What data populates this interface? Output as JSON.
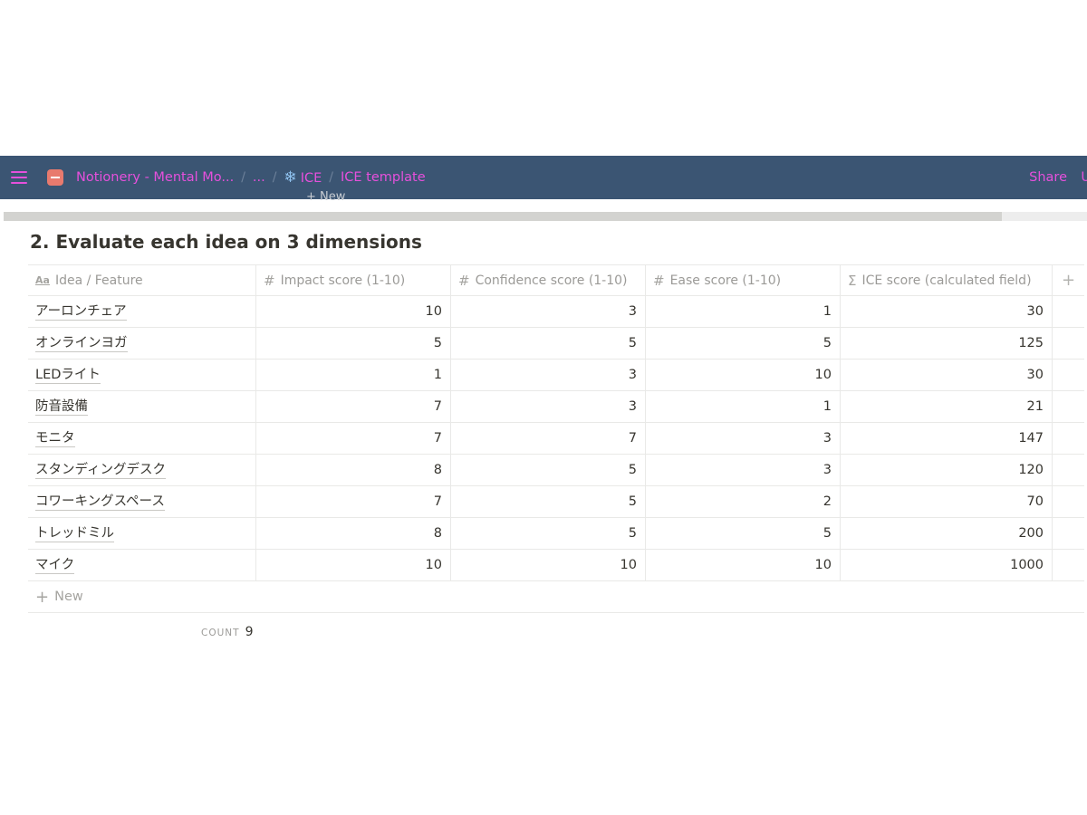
{
  "topbar": {
    "workspace": "Notionery - Mental Mo...",
    "ellipsis": "...",
    "ice": "ICE",
    "template": "ICE template",
    "share": "Share",
    "cut_item": "U",
    "snow_icon": "❄"
  },
  "ghost_new": "+ New",
  "heading": "2. Evaluate each idea on 3 dimensions",
  "table": {
    "columns": [
      {
        "icon": "Aa",
        "label": "Idea / Feature"
      },
      {
        "icon": "#",
        "label": "Impact score (1-10)"
      },
      {
        "icon": "#",
        "label": "Confidence score (1-10)"
      },
      {
        "icon": "#",
        "label": "Ease score (1-10)"
      },
      {
        "icon": "Σ",
        "label": "ICE score (calculated field)"
      }
    ],
    "add_column": "+",
    "rows": [
      {
        "idea": "アーロンチェア",
        "impact": "10",
        "confidence": "3",
        "ease": "1",
        "ice": "30"
      },
      {
        "idea": "オンラインヨガ",
        "impact": "5",
        "confidence": "5",
        "ease": "5",
        "ice": "125"
      },
      {
        "idea": "LEDライト",
        "impact": "1",
        "confidence": "3",
        "ease": "10",
        "ice": "30"
      },
      {
        "idea": "防音設備",
        "impact": "7",
        "confidence": "3",
        "ease": "1",
        "ice": "21"
      },
      {
        "idea": "モニタ",
        "impact": "7",
        "confidence": "7",
        "ease": "3",
        "ice": "147"
      },
      {
        "idea": "スタンディングデスク",
        "impact": "8",
        "confidence": "5",
        "ease": "3",
        "ice": "120"
      },
      {
        "idea": "コワーキングスペース",
        "impact": "7",
        "confidence": "5",
        "ease": "2",
        "ice": "70"
      },
      {
        "idea": "トレッドミル",
        "impact": "8",
        "confidence": "5",
        "ease": "5",
        "ice": "200"
      },
      {
        "idea": "マイク",
        "impact": "10",
        "confidence": "10",
        "ease": "10",
        "ice": "1000"
      }
    ],
    "new_label": "New",
    "new_plus": "+"
  },
  "footer": {
    "count_label": "COUNT",
    "count_value": "9"
  },
  "colors": {
    "topbar_bg": "#3b5573",
    "accent": "#e650dc"
  }
}
